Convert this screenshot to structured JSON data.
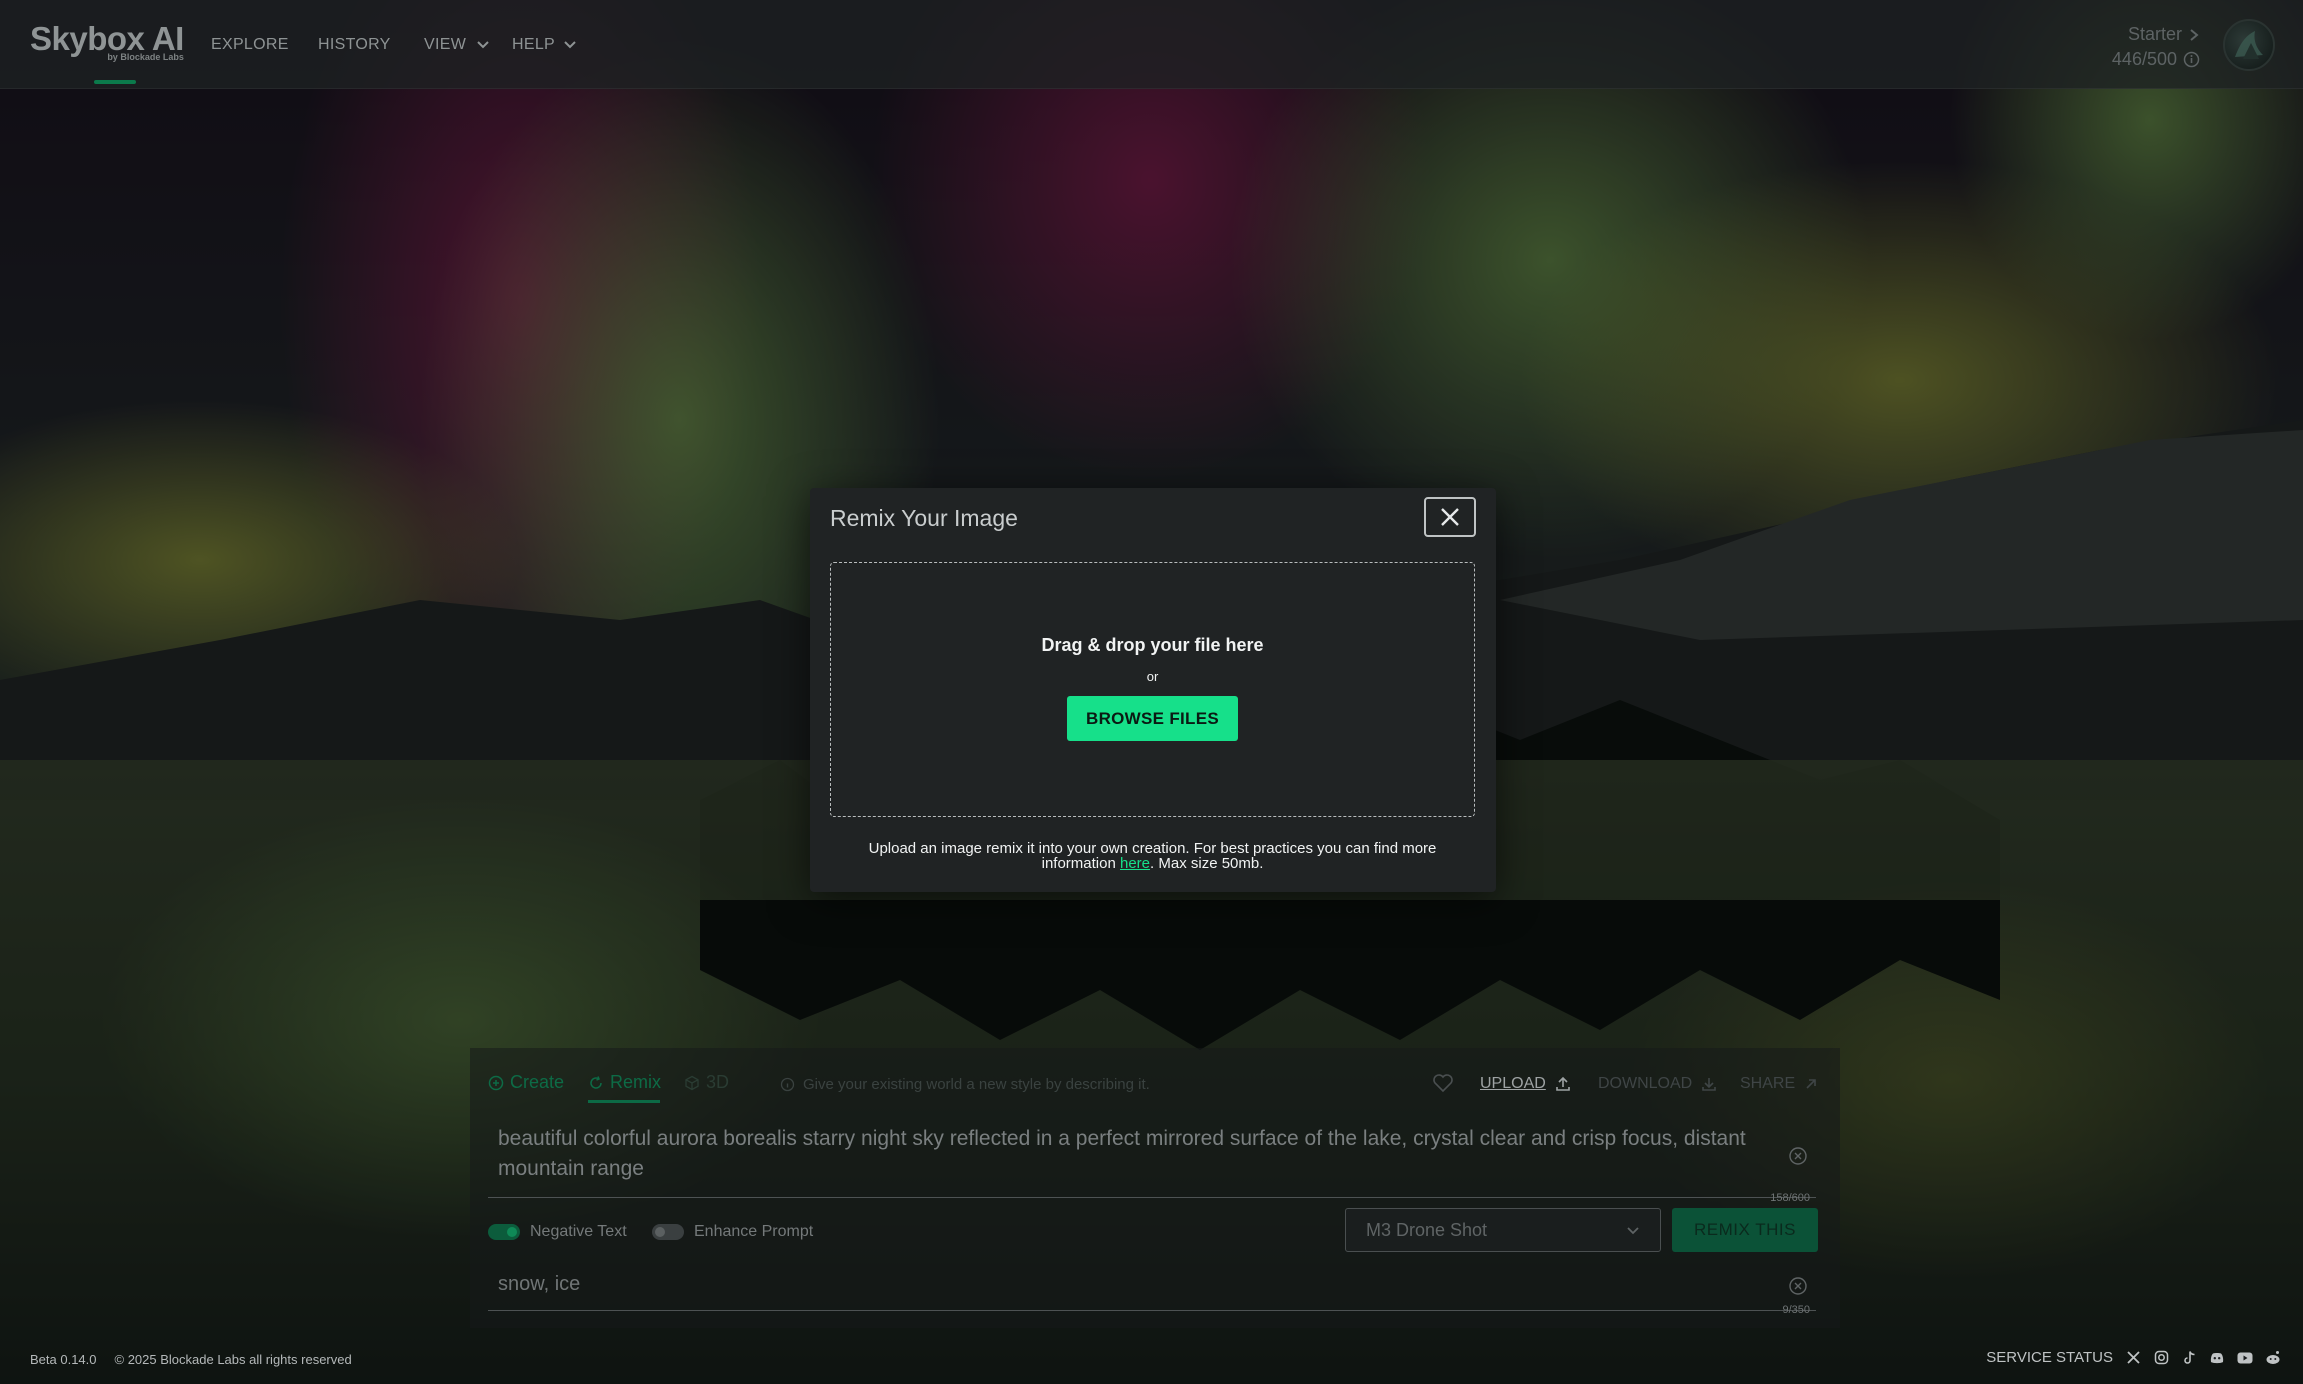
{
  "app": {
    "logo": "Skybox AI",
    "logo_by": "by Blockade Labs"
  },
  "nav": {
    "explore": "EXPLORE",
    "history": "HISTORY",
    "view": "VIEW",
    "help": "HELP"
  },
  "account": {
    "plan": "Starter",
    "credits": "446/500"
  },
  "tabs": {
    "create": "Create",
    "remix": "Remix",
    "three_d": "3D",
    "active": "Remix"
  },
  "toolbar": {
    "hint": "Give your existing world a new style by describing it.",
    "upload": "UPLOAD",
    "download": "DOWNLOAD",
    "share": "SHARE"
  },
  "prompt": {
    "text": "beautiful colorful aurora borealis starry night sky reflected in a perfect mirrored surface of the lake, crystal clear and crisp focus, distant mountain range",
    "counter": "158/600"
  },
  "options": {
    "negative_text_label": "Negative Text",
    "negative_text_on": true,
    "enhance_prompt_label": "Enhance Prompt",
    "enhance_prompt_on": false,
    "style_selected": "M3 Drone Shot",
    "remix_button": "REMIX THIS"
  },
  "negative": {
    "text": "snow, ice",
    "counter": "9/350"
  },
  "footer": {
    "version": "Beta 0.14.0",
    "copyright": "© 2025 Blockade Labs all rights reserved",
    "service_status": "SERVICE STATUS",
    "social_icons": [
      "x-icon",
      "instagram-icon",
      "tiktok-icon",
      "discord-icon",
      "youtube-icon",
      "reddit-icon"
    ]
  },
  "modal": {
    "title": "Remix Your Image",
    "drop_text": "Drag & drop your file here",
    "or": "or",
    "browse": "BROWSE FILES",
    "info_before": "Upload an image remix it into your own creation. For best practices you can find more information ",
    "info_link": "here",
    "info_after": ". Max size 50mb."
  },
  "colors": {
    "accent": "#16e08a",
    "modal_bg": "#202324"
  }
}
